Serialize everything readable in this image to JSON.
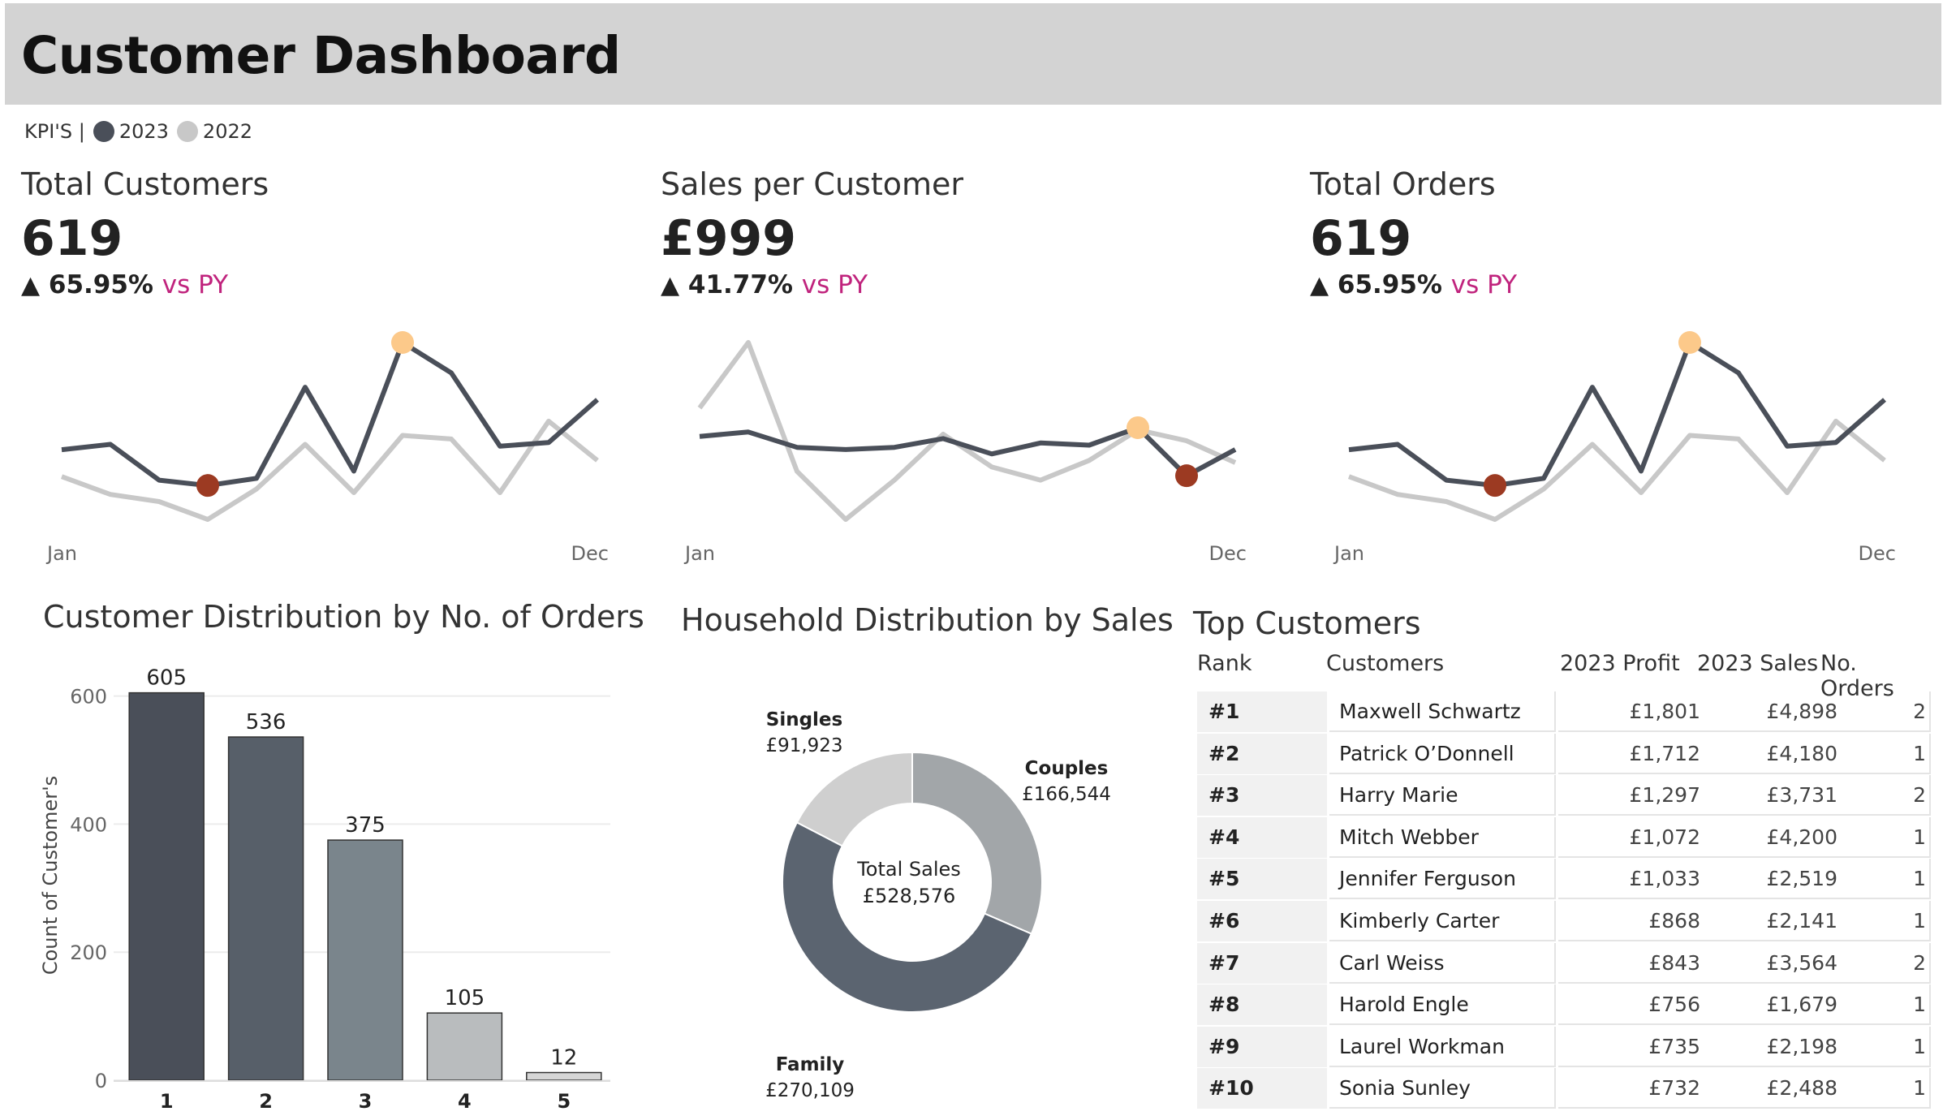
{
  "header": {
    "title": "Customer Dashboard"
  },
  "legend": {
    "prefix": "KPI'S |",
    "y2023": "2023",
    "y2022": "2022",
    "color_2023": "#4a4f59",
    "color_2022": "#c8c8c8"
  },
  "kpis": [
    {
      "label": "Total Customers",
      "value": "619",
      "change": "65.95%",
      "vs": "vs PY",
      "x_start": "Jan",
      "x_end": "Dec",
      "series_2023": [
        52,
        55,
        35,
        32,
        36,
        87,
        40,
        112,
        95,
        54,
        56,
        80
      ],
      "series_2022": [
        37,
        27,
        23,
        13,
        30,
        55,
        28,
        60,
        58,
        28,
        68,
        46
      ],
      "max_index": 7,
      "min_index": 3
    },
    {
      "label": "Sales per Customer",
      "value": "£999",
      "change": "41.77%",
      "vs": "vs PY",
      "x_start": "Jan",
      "x_end": "Dec",
      "series_2023": [
        52,
        54,
        47,
        46,
        47,
        51,
        44,
        49,
        48,
        56,
        34,
        46
      ],
      "series_2022": [
        65,
        95,
        36,
        14,
        32,
        53,
        38,
        32,
        41,
        55,
        50,
        40
      ],
      "max_index": 9,
      "min_index": 10
    },
    {
      "label": "Total Orders",
      "value": "619",
      "change": "65.95%",
      "vs": "vs PY",
      "x_start": "Jan",
      "x_end": "Dec",
      "series_2023": [
        52,
        55,
        35,
        32,
        36,
        87,
        40,
        112,
        95,
        54,
        56,
        80
      ],
      "series_2022": [
        37,
        27,
        23,
        13,
        30,
        55,
        28,
        60,
        58,
        28,
        68,
        46
      ],
      "max_index": 7,
      "min_index": 3
    }
  ],
  "bar_section": {
    "title": "Customer Distribution by No. of Orders"
  },
  "donut_section": {
    "title": "Household Distribution by Sales"
  },
  "table_section": {
    "title": "Top Customers",
    "columns": [
      "Rank",
      "Customers",
      "2023 Profit",
      "2023 Sales",
      "No. Orders"
    ],
    "rows": [
      [
        "#1",
        "Maxwell Schwartz",
        "£1,801",
        "£4,898",
        "2"
      ],
      [
        "#2",
        "Patrick O’Donnell",
        "£1,712",
        "£4,180",
        "1"
      ],
      [
        "#3",
        "Harry Marie",
        "£1,297",
        "£3,731",
        "2"
      ],
      [
        "#4",
        "Mitch Webber",
        "£1,072",
        "£4,200",
        "1"
      ],
      [
        "#5",
        "Jennifer Ferguson",
        "£1,033",
        "£2,519",
        "1"
      ],
      [
        "#6",
        "Kimberly Carter",
        "£868",
        "£2,141",
        "1"
      ],
      [
        "#7",
        "Carl Weiss",
        "£843",
        "£3,564",
        "2"
      ],
      [
        "#8",
        "Harold Engle",
        "£756",
        "£1,679",
        "1"
      ],
      [
        "#9",
        "Laurel Workman",
        "£735",
        "£2,198",
        "1"
      ],
      [
        "#10",
        "Sonia Sunley",
        "£732",
        "£2,488",
        "1"
      ]
    ]
  },
  "chart_data": [
    {
      "type": "bar",
      "title": "Customer Distribution by No. of Orders",
      "ylabel": "Count of Customer's",
      "xlabel": "",
      "categories": [
        "1",
        "2",
        "3",
        "4",
        "5"
      ],
      "values": [
        605,
        536,
        375,
        105,
        12
      ],
      "ylim": [
        0,
        640
      ],
      "yticks": [
        0,
        200,
        400,
        600
      ],
      "colors": [
        "#4a4f59",
        "#575f69",
        "#7a858c",
        "#b9bcbe",
        "#d6d6d6"
      ],
      "grid": true
    },
    {
      "type": "pie",
      "subtype": "donut",
      "title": "Household Distribution by Sales",
      "center_label": "Total Sales",
      "center_value": "£528,576",
      "slices": [
        {
          "label": "Couples",
          "value": 166544,
          "display": "£166,544",
          "color": "#a2a6a9"
        },
        {
          "label": "Family",
          "value": 270109,
          "display": "£270,109",
          "color": "#5b6470"
        },
        {
          "label": "Singles",
          "value": 91923,
          "display": "£91,923",
          "color": "#cfcfcf"
        }
      ]
    }
  ]
}
